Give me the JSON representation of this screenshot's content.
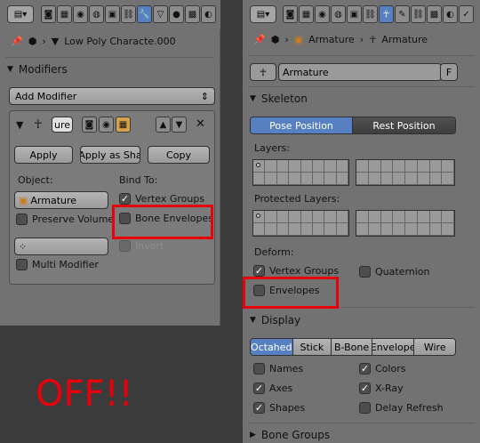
{
  "left": {
    "breadcrumb": "Low Poly Characte.000",
    "modifiers_header": "Modifiers",
    "add_modifier": "Add Modifier",
    "modifier_name": "ure",
    "apply": "Apply",
    "apply_shape": "Apply as Sha",
    "copy": "Copy",
    "object_label": "Object:",
    "object_value": "Armature",
    "bind_to_label": "Bind To:",
    "vertex_groups": "Vertex Groups",
    "bone_envelopes": "Bone Envelopes",
    "preserve_volume": "Preserve Volume",
    "invert": "Invert",
    "multi_modifier": "Multi Modifier"
  },
  "annotation": "OFF!!",
  "right": {
    "crumb_object": "Armature",
    "crumb_data": "Armature",
    "name_field": "Armature",
    "fake_user": "F",
    "skeleton_header": "Skeleton",
    "pose_position": "Pose Position",
    "rest_position": "Rest Position",
    "layers_label": "Layers:",
    "protected_layers_label": "Protected Layers:",
    "deform_label": "Deform:",
    "vertex_groups": "Vertex Groups",
    "quaternion": "Quaternion",
    "envelopes": "Envelopes",
    "display_header": "Display",
    "display_modes": [
      "Octahed",
      "Stick",
      "B-Bone",
      "Envelope",
      "Wire"
    ],
    "names": "Names",
    "colors": "Colors",
    "axes": "Axes",
    "xray": "X-Ray",
    "shapes": "Shapes",
    "delay_refresh": "Delay Refresh",
    "bone_groups_header": "Bone Groups"
  },
  "colors": {
    "highlight": "#e8000b",
    "selected": "#5680c2"
  }
}
